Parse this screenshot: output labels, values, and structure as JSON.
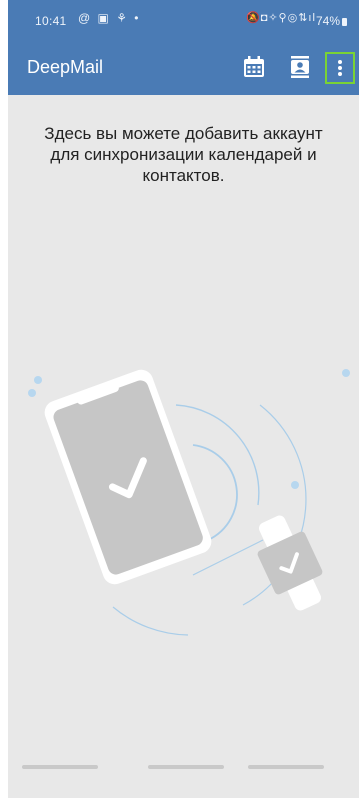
{
  "status_bar": {
    "time": "10:41",
    "notification_icons": "@ ▣ ⚘ •",
    "system_icons": "🔕◘✧⚲◎⇅ıl",
    "battery_level": "74%"
  },
  "app_bar": {
    "title": "DeepMail",
    "icons": [
      "calendar-icon",
      "contacts-icon",
      "more-vert-icon"
    ]
  },
  "content": {
    "message": "Здесь вы можете добавить аккаунт для синхронизации календарей и контактов."
  },
  "colors": {
    "app_bar": "#4a7bb5",
    "background": "#e8e8e8",
    "highlight": "#7ad334",
    "accent_dots": "#b7d7ef"
  }
}
